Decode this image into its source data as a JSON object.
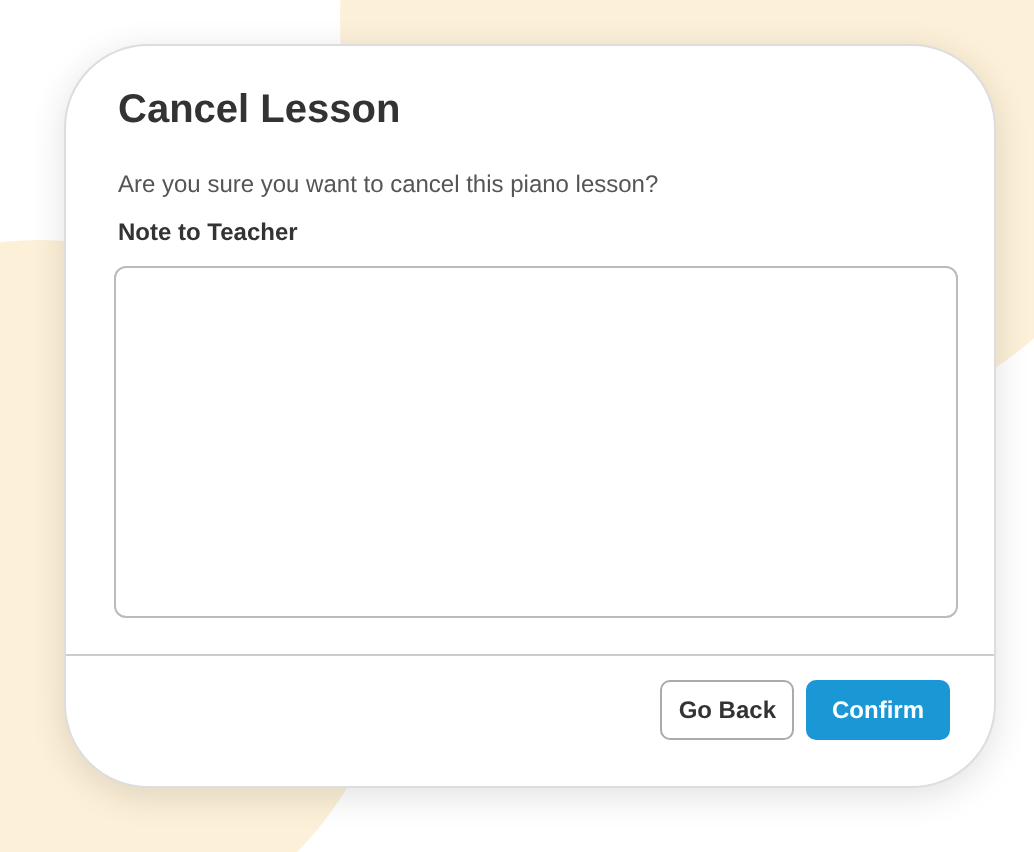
{
  "dialog": {
    "title": "Cancel Lesson",
    "message": "Are you sure you want to cancel this piano lesson?",
    "note_label": "Note to Teacher",
    "buttons": [
      {
        "label": "Go Back",
        "kind": "secondary"
      },
      {
        "label": "Confirm",
        "kind": "primary"
      }
    ]
  }
}
